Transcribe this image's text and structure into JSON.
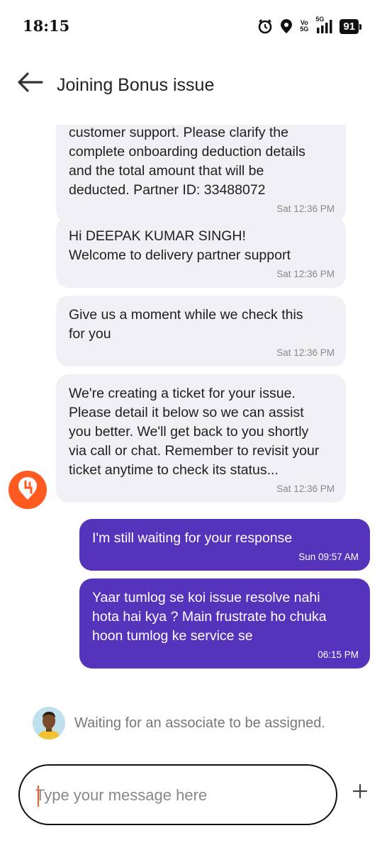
{
  "status_bar": {
    "time": "18:15",
    "network_top": "Vo",
    "network_bottom": "5G",
    "signal_label": "5G",
    "battery": "91"
  },
  "header": {
    "title": "Joining Bonus issue"
  },
  "messages": [
    {
      "direction": "incoming",
      "text": "customer support. Please clarify the\ncomplete onboarding deduction details\nand the total amount that will be\ndeducted. Partner ID: 33488072",
      "time": "Sat 12:36 PM"
    },
    {
      "direction": "incoming",
      "text": "Hi DEEPAK KUMAR SINGH!\nWelcome to delivery partner support",
      "time": "Sat 12:36 PM"
    },
    {
      "direction": "incoming",
      "text": "Give us a moment while we check this\nfor you",
      "time": "Sat 12:36 PM"
    },
    {
      "direction": "incoming",
      "text": "We're creating a ticket for your issue.\nPlease detail it below so we can assist\nyou better. We'll get back to you shortly\nvia call or chat. Remember to revisit your\nticket anytime to check its status...",
      "time": "Sat 12:36 PM"
    },
    {
      "direction": "outgoing",
      "text": "I'm still waiting for your response",
      "time": "Sun 09:57 AM"
    },
    {
      "direction": "outgoing",
      "text": "Yaar tumlog se koi issue resolve nahi\nhota hai kya ? Main frustrate ho chuka\nhoon tumlog ke service se",
      "time": "06:15 PM"
    }
  ],
  "waiting": {
    "text": "Waiting for an associate to be assigned."
  },
  "composer": {
    "placeholder": "Type your message here",
    "value": ""
  },
  "colors": {
    "brand_orange": "#ff5a1f",
    "outgoing_bubble": "#5533bb",
    "incoming_bubble": "#f0f0f5"
  },
  "icons": {
    "back": "arrow-left-icon",
    "bot_avatar": "swiggy-logo-icon",
    "agent_avatar": "person-avatar-icon",
    "attach": "plus-icon"
  }
}
